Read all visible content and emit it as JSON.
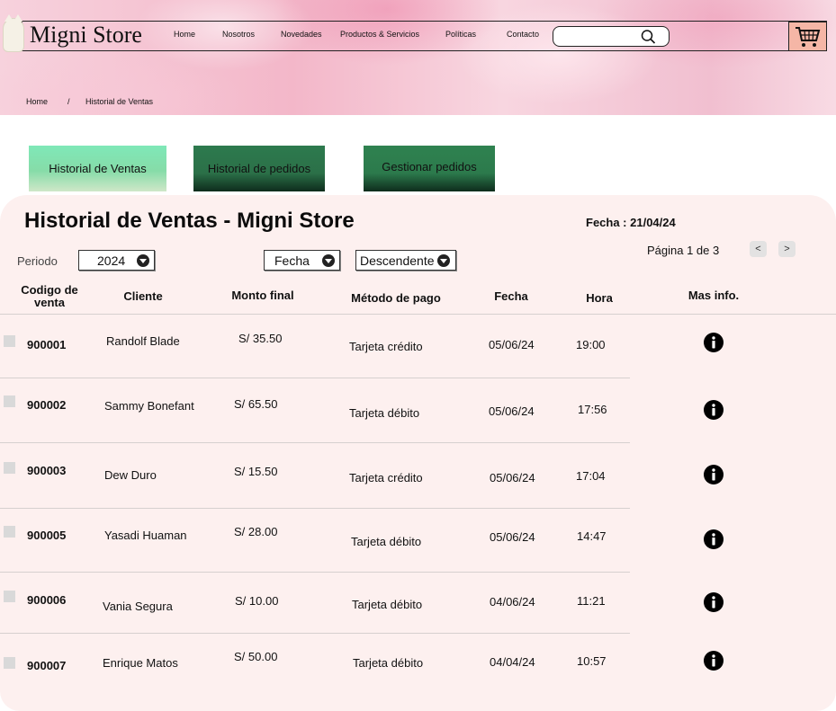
{
  "header": {
    "brand": "Migni Store",
    "nav": [
      "Home",
      "Nosotros",
      "Novedades",
      "Productos & Servicios",
      "Políticas",
      "Contacto"
    ],
    "search_placeholder": ""
  },
  "breadcrumb": {
    "home": "Home",
    "separator": "/",
    "current": "Historial de Ventas"
  },
  "tabs": [
    "Historial de Ventas",
    "Historial de pedidos",
    "Gestionar pedidos"
  ],
  "page": {
    "title": "Historial de Ventas - Migni Store",
    "date": "Fecha : 21/04/24",
    "pagination": "Página 1 de 3",
    "prev": "<",
    "next": ">"
  },
  "filters": {
    "period_label": "Periodo",
    "period_value": "2024",
    "sort_field": "Fecha",
    "sort_order": "Descendente"
  },
  "table": {
    "headers": [
      "Codigo de venta",
      "Cliente",
      "Monto final",
      "Método de pago",
      "Fecha",
      "Hora",
      "Mas info."
    ],
    "rows": [
      {
        "code": "900001",
        "client": "Randolf Blade",
        "amount": "S/ 35.50",
        "payment": "Tarjeta crédito",
        "date": "05/06/24",
        "time": "19:00"
      },
      {
        "code": "900002",
        "client": "Sammy Bonefant",
        "amount": "S/ 65.50",
        "payment": "Tarjeta débito",
        "date": "05/06/24",
        "time": "17:56"
      },
      {
        "code": "900003",
        "client": "Dew Duro",
        "amount": "S/ 15.50",
        "payment": "Tarjeta crédito",
        "date": "05/06/24",
        "time": "17:04"
      },
      {
        "code": "900005",
        "client": "Yasadi Huaman",
        "amount": "S/ 28.00",
        "payment": "Tarjeta débito",
        "date": "05/06/24",
        "time": "14:47"
      },
      {
        "code": "900006",
        "client": "Vania Segura",
        "amount": "S/ 10.00",
        "payment": "Tarjeta débito",
        "date": "04/06/24",
        "time": "11:21"
      },
      {
        "code": "900007",
        "client": "Enrique Matos",
        "amount": "S/ 50.00",
        "payment": "Tarjeta débito",
        "date": "04/04/24",
        "time": "10:57"
      }
    ]
  },
  "colors": {
    "tab_active": "#86dca8",
    "tab_dark": "#2c7a4c",
    "panel": "#fdf0ef",
    "cart_bg": "#f5b6a6"
  }
}
